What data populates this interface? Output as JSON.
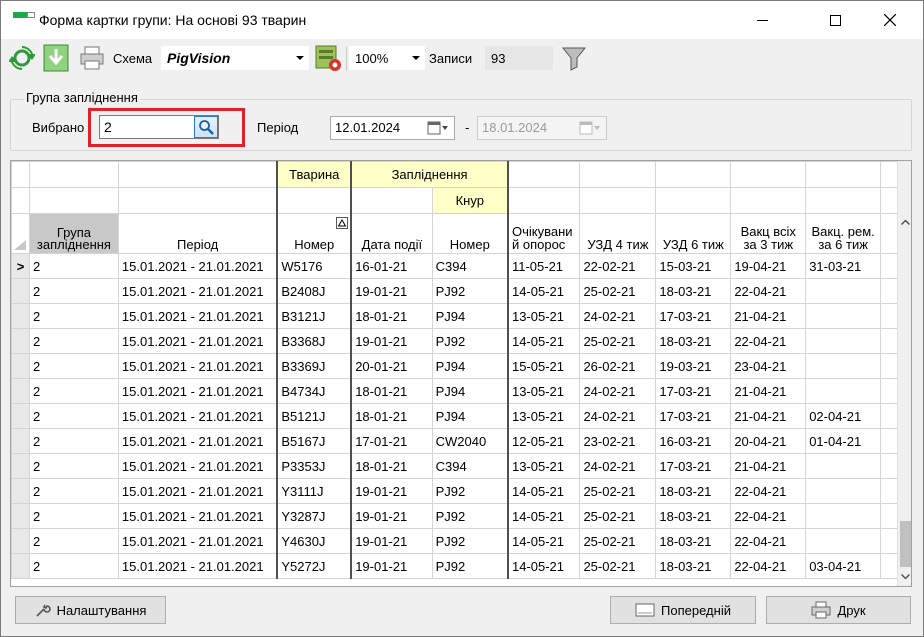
{
  "window": {
    "title": "Форма картки групи: На основі 93 тварин"
  },
  "toolbar": {
    "scheme_label": "Схема",
    "scheme_value": "PigVision",
    "zoom_value": "100%",
    "records_label": "Записи",
    "records_count": "93"
  },
  "filter": {
    "group_title": "Група запліднення",
    "selected_label": "Вибрано",
    "selected_value": "2",
    "period_label": "Період",
    "date_from": "12.01.2024",
    "date_sep": "-",
    "date_to": "18.01.2024"
  },
  "grid": {
    "group_headers": {
      "animal": "Тварина",
      "insemination": "Запліднення",
      "boar": "Кнур"
    },
    "columns": [
      "Група запліднення",
      "Період",
      "Номер",
      "Дата події",
      "Номер",
      "Очікувани й опорос",
      "УЗД 4 тиж",
      "УЗД 6 тиж",
      "Вакц всіх за 3 тиж",
      "Вакц. рем. за 6 тиж"
    ],
    "current_row_marker": ">",
    "rows": [
      [
        "2",
        "15.01.2021 - 21.01.2021",
        "W5176",
        "16-01-21",
        "C394",
        "11-05-21",
        "22-02-21",
        "15-03-21",
        "19-04-21",
        "31-03-21"
      ],
      [
        "2",
        "15.01.2021 - 21.01.2021",
        "B2408J",
        "19-01-21",
        "PJ92",
        "14-05-21",
        "25-02-21",
        "18-03-21",
        "22-04-21",
        ""
      ],
      [
        "2",
        "15.01.2021 - 21.01.2021",
        "B3121J",
        "18-01-21",
        "PJ94",
        "13-05-21",
        "24-02-21",
        "17-03-21",
        "21-04-21",
        ""
      ],
      [
        "2",
        "15.01.2021 - 21.01.2021",
        "B3368J",
        "19-01-21",
        "PJ92",
        "14-05-21",
        "25-02-21",
        "18-03-21",
        "22-04-21",
        ""
      ],
      [
        "2",
        "15.01.2021 - 21.01.2021",
        "B3369J",
        "20-01-21",
        "PJ94",
        "15-05-21",
        "26-02-21",
        "19-03-21",
        "23-04-21",
        ""
      ],
      [
        "2",
        "15.01.2021 - 21.01.2021",
        "B4734J",
        "18-01-21",
        "PJ94",
        "13-05-21",
        "24-02-21",
        "17-03-21",
        "21-04-21",
        ""
      ],
      [
        "2",
        "15.01.2021 - 21.01.2021",
        "B5121J",
        "18-01-21",
        "PJ94",
        "13-05-21",
        "24-02-21",
        "17-03-21",
        "21-04-21",
        "02-04-21"
      ],
      [
        "2",
        "15.01.2021 - 21.01.2021",
        "B5167J",
        "17-01-21",
        "CW2040",
        "12-05-21",
        "23-02-21",
        "16-03-21",
        "20-04-21",
        "01-04-21"
      ],
      [
        "2",
        "15.01.2021 - 21.01.2021",
        "P3353J",
        "18-01-21",
        "C394",
        "13-05-21",
        "24-02-21",
        "17-03-21",
        "21-04-21",
        ""
      ],
      [
        "2",
        "15.01.2021 - 21.01.2021",
        "Y3111J",
        "19-01-21",
        "PJ92",
        "14-05-21",
        "25-02-21",
        "18-03-21",
        "22-04-21",
        ""
      ],
      [
        "2",
        "15.01.2021 - 21.01.2021",
        "Y3287J",
        "19-01-21",
        "PJ92",
        "14-05-21",
        "25-02-21",
        "18-03-21",
        "22-04-21",
        ""
      ],
      [
        "2",
        "15.01.2021 - 21.01.2021",
        "Y4630J",
        "19-01-21",
        "PJ92",
        "14-05-21",
        "25-02-21",
        "18-03-21",
        "22-04-21",
        ""
      ],
      [
        "2",
        "15.01.2021 - 21.01.2021",
        "Y5272J",
        "19-01-21",
        "PJ92",
        "14-05-21",
        "25-02-21",
        "18-03-21",
        "22-04-21",
        "03-04-21"
      ]
    ]
  },
  "footer": {
    "settings_label": "Налаштування",
    "preview_label": "Попередній",
    "print_label": "Друк"
  },
  "colors": {
    "highlight_red": "#e0202a",
    "header_yellow": "#ffffc8",
    "accent_blue": "#2a7ad6"
  }
}
